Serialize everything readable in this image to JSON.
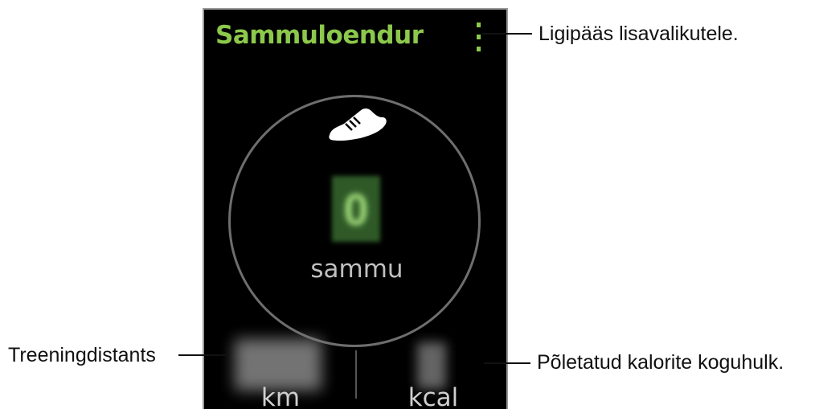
{
  "app": {
    "title": "Sammuloendur",
    "steps_value": "0",
    "steps_unit": "sammu",
    "distance_unit": "km",
    "calories_unit": "kcal",
    "accent_color": "#8cc84b"
  },
  "icons": {
    "menu": "more-options-icon",
    "activity": "shoe-icon"
  },
  "callouts": {
    "menu": "Ligipääs lisavalikutele.",
    "distance": "Treeningdistants",
    "calories": "Põletatud kalorite koguhulk."
  }
}
